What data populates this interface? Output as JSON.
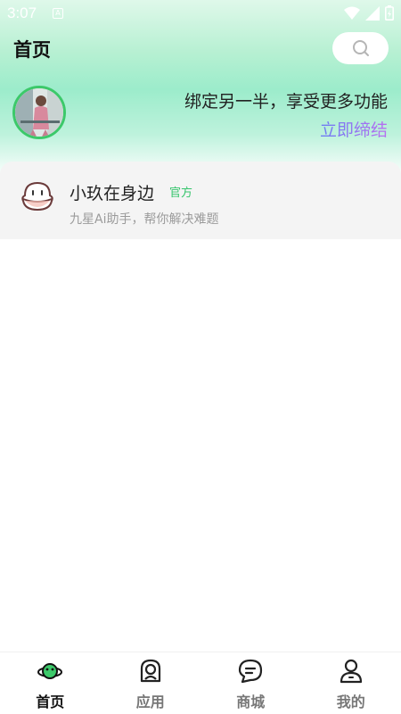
{
  "status_bar": {
    "time": "3:07",
    "notification_glyph": "A"
  },
  "header": {
    "title": "首页",
    "search_icon": "search-icon"
  },
  "banner": {
    "bind_text": "绑定另一半，享受更多功能",
    "bind_link": "立即缔结"
  },
  "assistant_card": {
    "name": "小玖在身边",
    "badge": "官方",
    "description": "九星Ai助手，帮你解决难题"
  },
  "tabbar": {
    "items": [
      {
        "label": "首页",
        "icon": "home-planet-icon",
        "active": true
      },
      {
        "label": "应用",
        "icon": "apps-icon",
        "active": false
      },
      {
        "label": "商城",
        "icon": "shop-chat-icon",
        "active": false
      },
      {
        "label": "我的",
        "icon": "profile-icon",
        "active": false
      }
    ]
  },
  "colors": {
    "accent_green": "#37c56d",
    "link_start": "#6c7df2",
    "link_end": "#b96ff0"
  }
}
